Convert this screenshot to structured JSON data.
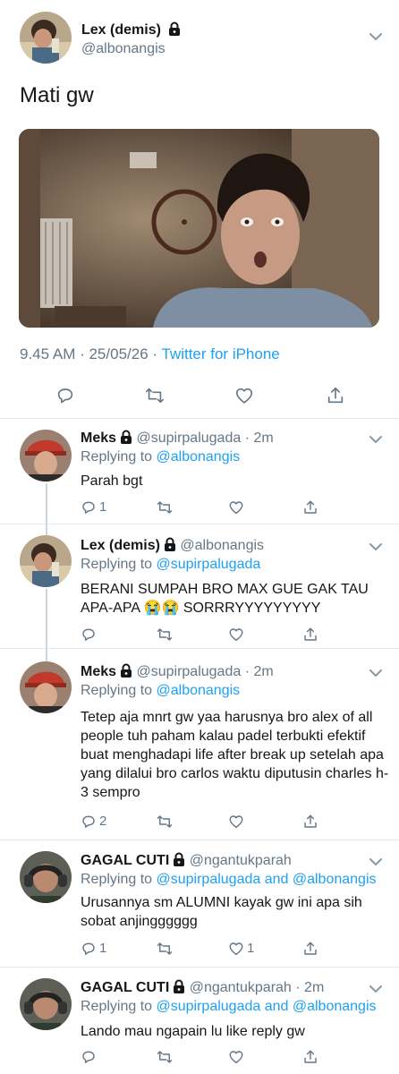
{
  "colors": {
    "link": "#1da1f2",
    "muted": "#657786",
    "text": "#14171a",
    "divider": "#e1e8ed"
  },
  "main_tweet": {
    "author_name": "Lex (demis)",
    "handle": "@albonangis",
    "text": "Mati gw",
    "timestamp": "9.45 AM · 25/05/26 · ",
    "source": "Twitter for iPhone",
    "icons": [
      "reply-icon",
      "retweet-icon",
      "like-icon",
      "share-icon"
    ]
  },
  "replies": [
    {
      "name": "Meks",
      "handle": "@supirpalugada",
      "time": "· 2m",
      "replying_label": "Replying to ",
      "replying_to": "@albonangis",
      "text": "Parah bgt",
      "reply_count": "1",
      "like_count": ""
    },
    {
      "name": "Lex (demis)",
      "handle": "@albonangis",
      "time": "",
      "replying_label": "Replying to ",
      "replying_to": "@supirpalugada",
      "text": "BERANI SUMPAH BRO MAX GUE GAK TAU APA-APA 😭😭 SORRRYYYYYYYYY",
      "reply_count": "",
      "like_count": ""
    },
    {
      "name": "Meks",
      "handle": "@supirpalugada",
      "time": "· 2m",
      "replying_label": "Replying to ",
      "replying_to": "@albonangis",
      "text": "Tetep aja mnrt gw yaa harusnya bro alex of all people tuh paham kalau padel terbukti efektif buat menghadapi life after break up setelah apa yang dilalui bro carlos waktu diputusin charles h-3 sempro",
      "reply_count": "2",
      "like_count": ""
    },
    {
      "name": "GAGAL CUTI",
      "handle": "@ngantukparah",
      "time": "",
      "replying_label": "Replying to ",
      "replying_to": "@supirpalugada and @albonangis",
      "text": "Urusannya sm ALUMNI kayak gw ini apa sih sobat anjingggggg",
      "reply_count": "1",
      "like_count": "1"
    },
    {
      "name": "GAGAL CUTI",
      "handle": "@ngantukparah",
      "time": "· 2m",
      "replying_label": "Replying to ",
      "replying_to": "@supirpalugada and @albonangis",
      "text": "Lando mau ngapain lu like reply gw",
      "reply_count": "",
      "like_count": ""
    }
  ]
}
